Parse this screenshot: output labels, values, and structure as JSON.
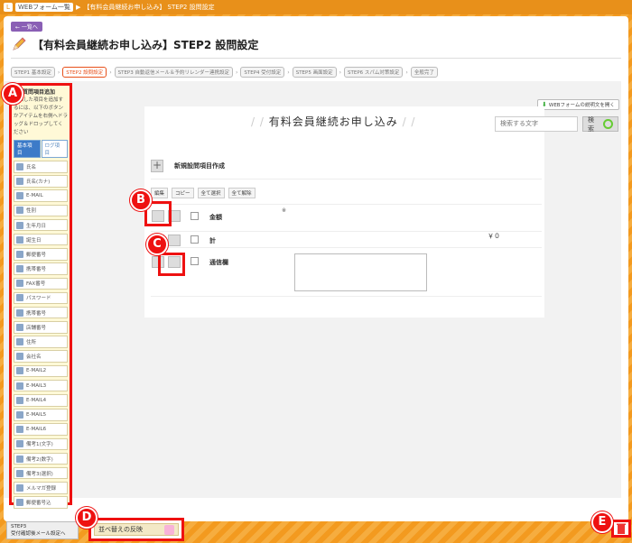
{
  "topbar": {
    "crumb1": "WEBフォーム一覧",
    "sep": "▶",
    "crumb2": "【有料会員継続お申し込み】 STEP2 設問設定"
  },
  "header": {
    "back": "← 一覧へ",
    "title": "【有料会員継続お申し込み】STEP2 設問設定"
  },
  "steps": [
    {
      "label": "STEP1 基本設定"
    },
    {
      "label": "STEP2 設問設定"
    },
    {
      "label": "STEP3 自動返信メール＆予約リレンダー連携設定"
    },
    {
      "label": "STEP4 受付設定"
    },
    {
      "label": "STEP5 画面設定"
    },
    {
      "label": "STEP6 スパム対策設定"
    },
    {
      "label": "全般完了"
    }
  ],
  "sidebar": {
    "title": "質問項目追加",
    "description": "追加した項目を追加するには、以下のボタンかアイテムを右側へドラッグ＆ドロップしてください",
    "tabs": [
      "基本項目",
      "ログ項目"
    ],
    "items": [
      "氏名",
      "氏名(カナ)",
      "E-MAIL",
      "性別",
      "生年月日",
      "誕生日",
      "郵便番号",
      "携帯番号",
      "FAX番号",
      "パスワード",
      "携帯番号",
      "店舗番号",
      "住所",
      "会社名",
      "E-MAIL2",
      "E-MAIL3",
      "E-MAIL4",
      "E-MAIL5",
      "E-MAIL6",
      "備考1(文字)",
      "備考2(数字)",
      "備考3(選択)",
      "メルマガ登録",
      "郵便番号込"
    ]
  },
  "guide_button": "WEBフォームの説明文を開く",
  "form": {
    "title": "有料会員継続お申し込み",
    "search_placeholder": "検索する文字",
    "search_button": "検索",
    "new_item": "新規設問項目作成"
  },
  "mini_tabs": {
    "edit": "編集",
    "copy": "コピー",
    "select_all": "全て選択",
    "deselect_all": "全て解除"
  },
  "questions": [
    {
      "label": "金額",
      "mark": "※",
      "value": ""
    },
    {
      "label": "計",
      "mark": "",
      "value": "￥０"
    },
    {
      "label": "通信欄",
      "mark": "",
      "value": ""
    }
  ],
  "bottom": {
    "step3": "STEP3\n受付確認後メール設定へ",
    "sort": "並べ替えの反映"
  },
  "badges": [
    "A",
    "B",
    "C",
    "D",
    "E"
  ]
}
